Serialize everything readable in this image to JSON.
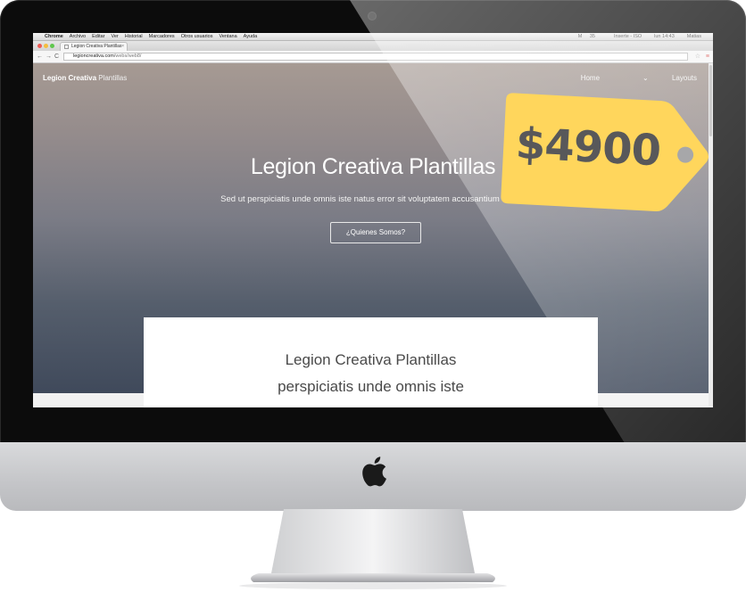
{
  "menubar": {
    "apple_glyph": "",
    "app_name": "Chrome",
    "items": [
      "Archivo",
      "Editar",
      "Ver",
      "Historial",
      "Marcadores",
      "Otros usuarios",
      "Ventana",
      "Ayuda"
    ],
    "status_left": "35",
    "status_middle": "Inserte - ISO",
    "clock": "lun 14:43",
    "user": "Matias"
  },
  "browser": {
    "tab_title": "Legion Creativa Plantillas",
    "tab_close": "×",
    "url_host": "legioncreativa.com",
    "url_path": "/webs/web8/",
    "back_glyph": "←",
    "forward_glyph": "→",
    "reload_glyph": "C",
    "star_glyph": "☆",
    "menu_glyph": "≡"
  },
  "site": {
    "brand_bold": "Legion Creativa",
    "brand_light": " Plantillas",
    "nav": {
      "home": "Home",
      "layouts": "Layouts"
    },
    "hero_title": "Legion Creativa Plantillas",
    "hero_subtitle": "Sed ut perspiciatis unde omnis iste natus error sit voluptatem accusantium dolore",
    "hero_button": "¿Quienes Somos?",
    "card_line1": "Legion Creativa Plantillas",
    "card_line2": "perspiciatis unde omnis iste"
  },
  "price_tag": {
    "price": "$4900",
    "tag_color": "#ffd65c",
    "text_color": "#58585a"
  },
  "colors": {
    "hero_top": "#a69a93",
    "hero_bottom": "#3c4658",
    "frame": "#0c0c0c",
    "chin": "#c9cacd"
  },
  "icons": {
    "logo": "apple-logo",
    "traffic": [
      "close-dot",
      "minimize-dot",
      "zoom-dot"
    ]
  }
}
